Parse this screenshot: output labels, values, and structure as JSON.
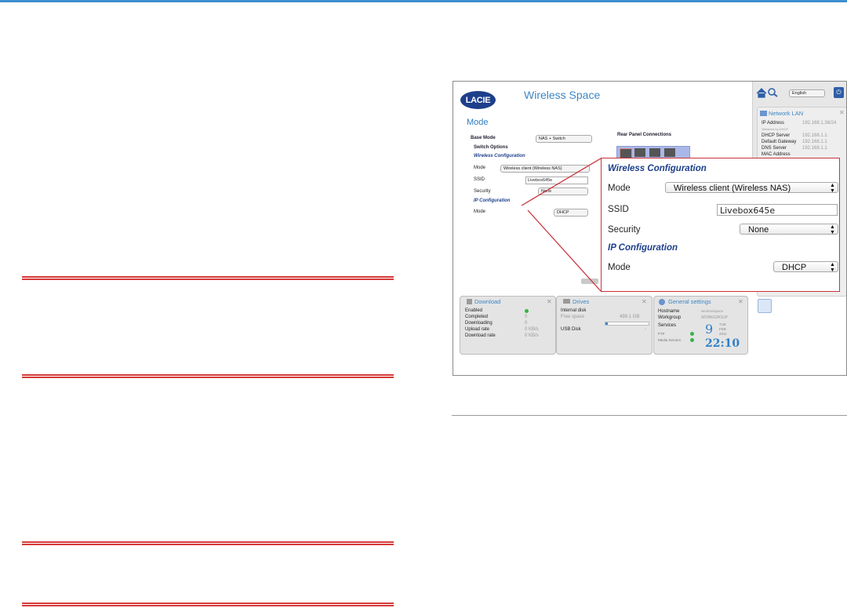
{
  "window": {
    "logo_text": "LACIE",
    "app_title": "Wireless Space",
    "language_select": "English",
    "mode_heading": "Mode"
  },
  "mode_page": {
    "base_mode_label": "Base Mode",
    "base_mode_value": "NAS + Switch",
    "switch_options": "Switch Options",
    "wireless_config": "Wireless Configuration",
    "mode_label": "Mode",
    "mode_value": "Wireless client (Wireless NAS)",
    "ssid_label": "SSID",
    "ssid_value": "Livebox645e",
    "security_label": "Security",
    "security_value": "None",
    "ip_config": "IP Configuration",
    "ip_mode_label": "Mode",
    "ip_mode_value": "DHCP",
    "rear_panel": "Rear Panel Connections"
  },
  "network_lan": {
    "title": "Network LAN",
    "ip_label": "IP Address",
    "ip_value": "192.168.1.36/24",
    "obtained": "Obtained by DHCP",
    "dhcp_label": "DHCP Server",
    "dhcp_value": "192.168.1.1",
    "gw_label": "Default Gateway",
    "gw_value": "192.168.1.1",
    "dns_label": "DNS Server",
    "dns_value": "192.168.1.1",
    "mac_label": "MAC Address"
  },
  "download": {
    "title": "Download",
    "rows": [
      {
        "label": "Enabled",
        "value": ""
      },
      {
        "label": "Completed",
        "value": "0"
      },
      {
        "label": "Downloading",
        "value": "0"
      },
      {
        "label": "Upload rate",
        "value": "0 KB/s"
      },
      {
        "label": "Download rate",
        "value": "0 KB/s"
      }
    ]
  },
  "drives": {
    "title": "Drives",
    "internal": "Internal disk",
    "free_label": "Free space",
    "free_value": "499.1 GB",
    "usb": "USB Disk",
    "usb_value": "-"
  },
  "general": {
    "title": "General settings",
    "hostname_label": "Hostname",
    "hostname_value": "wirelessspace",
    "workgroup_label": "Workgroup",
    "workgroup_value": "WORKGROUP",
    "services_label": "Services",
    "ftp_label": "FTP",
    "media_label": "Media Servers",
    "day_num": "9",
    "day_name": "TUE",
    "month": "FEB",
    "year": "2011",
    "time": "22:10"
  },
  "zoom": {
    "wireless_config": "Wireless Configuration",
    "mode_label": "Mode",
    "mode_value": "Wireless client (Wireless NAS)",
    "ssid_label": "SSID",
    "ssid_value": "Livebox645e",
    "security_label": "Security",
    "security_value": "None",
    "ip_config": "IP Configuration",
    "ip_mode_label": "Mode",
    "ip_mode_value": "DHCP"
  },
  "colors": {
    "accent": "#3d86c4",
    "rule_red": "#d63a3a",
    "callout_red": "#c8333a",
    "logo_blue": "#1d3f8a"
  }
}
